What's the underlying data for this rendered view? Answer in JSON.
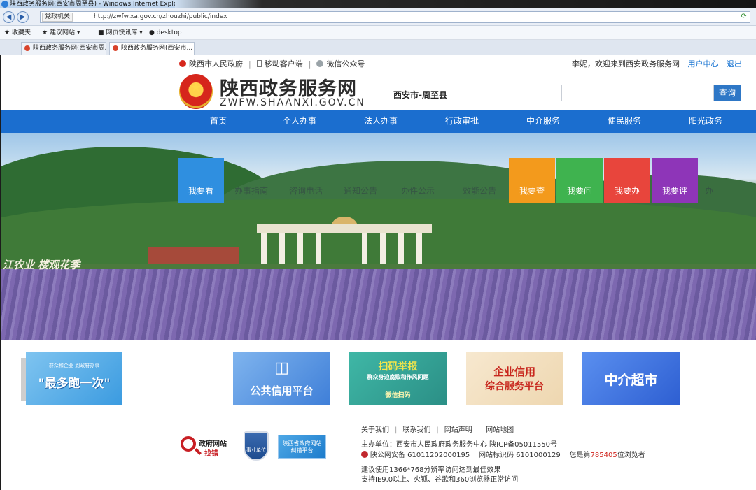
{
  "browser": {
    "window_title": "陕西政务服务网(西安市周至县) - Windows Internet Explorer",
    "zone": "党政机关",
    "url": "http://zwfw.xa.gov.cn/zhouzhi/public/index",
    "favorites": [
      "收藏夹",
      "建议网站",
      "网页快讯库",
      "desktop"
    ],
    "tabs": [
      {
        "label": "陕西政务服务网(西安市周..."
      },
      {
        "label": "陕西政务服务网(西安市..."
      }
    ]
  },
  "top": {
    "links": [
      "陕西市人民政府",
      "移动客户端",
      "微信公众号"
    ],
    "welcome": "李妮，欢迎来到西安政务服务网",
    "user_center": "用户中心",
    "logout": "退出"
  },
  "header": {
    "logo_cn": "陕西政务服务网",
    "logo_en": "ZWFW.SHAANXI.GOV.CN",
    "region": "西安市-周至县",
    "search_button": "查询"
  },
  "nav": [
    "首页",
    "个人办事",
    "法人办事",
    "行政审批",
    "中介服务",
    "便民服务",
    "阳光政务"
  ],
  "banner": {
    "sign_text": "江农业 楼观花季",
    "left_tabs": [
      {
        "label": "我要看",
        "color": "#2f8fe0"
      },
      {
        "label": "办事指南"
      },
      {
        "label": "咨询电话"
      },
      {
        "label": "通知公告"
      },
      {
        "label": "办件公示"
      },
      {
        "label": "效能公告"
      }
    ],
    "right_tabs": [
      {
        "label": "我要查",
        "color": "#f39a1c"
      },
      {
        "label": "我要问",
        "color": "#3fb34f"
      },
      {
        "label": "我要办",
        "color": "#e8453c"
      },
      {
        "label": "我要评",
        "color": "#8e35b8"
      }
    ],
    "cut_char": "办"
  },
  "cards": [
    {
      "title": "\"最多跑一次\"",
      "subtitle": "群众和企业  到政府办事"
    },
    {
      "title": "公共信用平台"
    },
    {
      "title": "扫码举报",
      "subtitle": "群众身边腐败和作风问题",
      "side": "微信扫码"
    },
    {
      "title": "企业信用",
      "title2": "综合服务平台"
    },
    {
      "title": "中介超市"
    }
  ],
  "footer": {
    "badge1_line1": "政府网站",
    "badge1_line2": "找错",
    "badge2": "事业单位",
    "badge3_line1": "陕西省政府网站",
    "badge3_line2": "纠错平台",
    "links": [
      "关于我们",
      "联系我们",
      "网站声明",
      "网站地图"
    ],
    "sponsor": "主办单位：西安市人民政府政务服务中心   陕ICP备05011550号",
    "police_id": "陕公网安备 61011202000195",
    "site_code": "网站标识码 6101000129",
    "visitor_prefix": "您是第",
    "visitor_count": "785405",
    "visitor_suffix": "位浏览者",
    "tip1": "建议使用1366*768分辨率访问达到最佳效果",
    "tip2": "支持IE9.0以上、火狐、谷歌和360浏览器正常访问"
  }
}
